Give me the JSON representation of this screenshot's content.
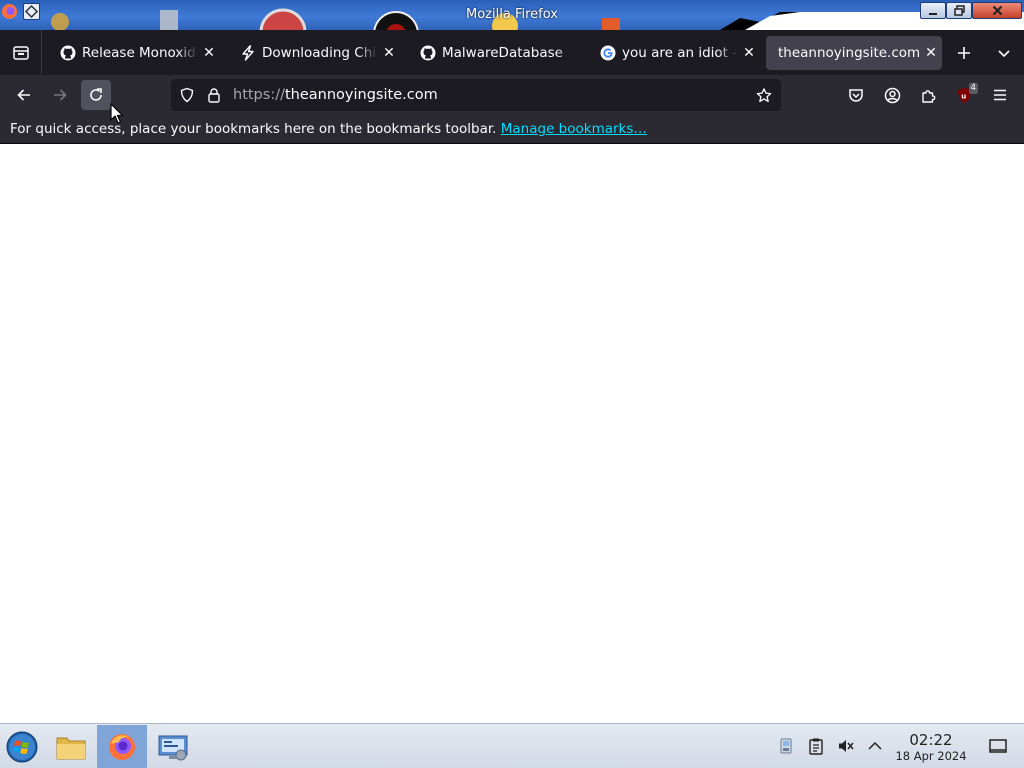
{
  "window": {
    "title": "Mozilla Firefox",
    "controls": [
      "minimize",
      "restore",
      "close"
    ]
  },
  "tabs": [
    {
      "label": "Release Monoxide",
      "favicon": "github-icon",
      "active": false
    },
    {
      "label": "Downloading Chilli",
      "favicon": "lightning-icon",
      "active": false
    },
    {
      "label": "MalwareDatabase",
      "favicon": "github-icon",
      "active": false
    },
    {
      "label": "you are an idiot - G",
      "favicon": "google-icon",
      "active": false
    },
    {
      "label": "theannoyingsite.com/",
      "favicon": "none",
      "active": true
    }
  ],
  "navbar": {
    "url_scheme": "https://",
    "url_host": "theannoyingsite.com",
    "extension_badge": "4",
    "icons": [
      "back-icon",
      "forward-icon",
      "reload-icon",
      "shield-icon",
      "lock-icon",
      "star-icon",
      "pocket-icon",
      "account-icon",
      "extensions-icon",
      "ublock-icon",
      "menu-icon"
    ]
  },
  "bookmarks_toolbar": {
    "message": "For quick access, place your bookmarks here on the bookmarks toolbar.",
    "link": "Manage bookmarks…"
  },
  "taskbar": {
    "items": [
      "start-orb",
      "file-manager",
      "firefox",
      "control-panel"
    ],
    "tray": [
      "network-icon",
      "clipboard-icon",
      "volume-muted-icon",
      "tray-expand-icon"
    ],
    "time": "02:22",
    "date": "18 Apr 2024"
  },
  "colors": {
    "toolbar": "#2b2a33",
    "tabstrip": "#1c1b22",
    "active_tab": "#42414d",
    "link": "#00ddff",
    "taskbar": "#d2dae6"
  }
}
